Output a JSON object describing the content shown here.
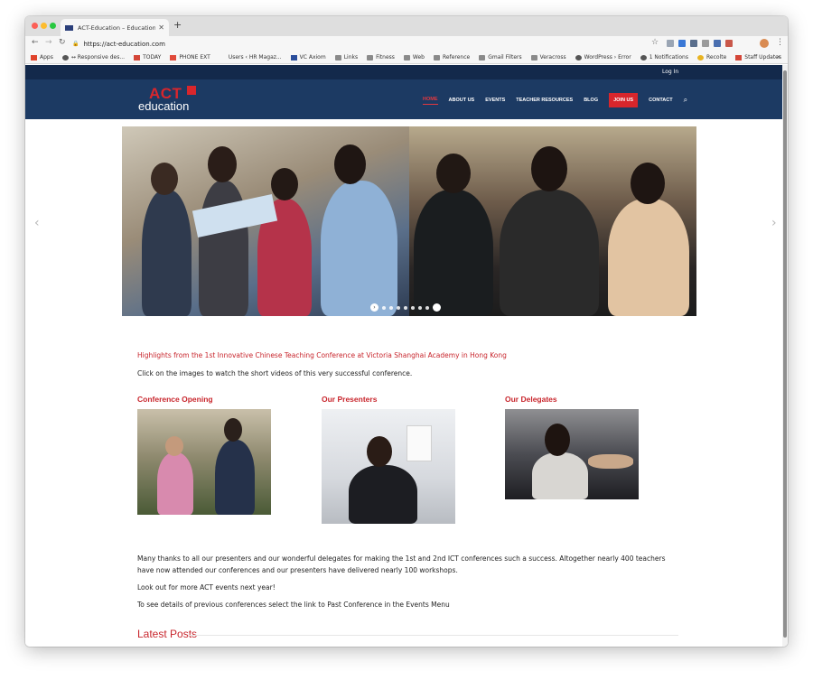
{
  "browser": {
    "tab_title": "ACT-Education – Educational",
    "url": "https://act-education.com",
    "bookmarks": [
      {
        "label": "Apps",
        "icon": "apps-icon"
      },
      {
        "label": "↔ Responsive des...",
        "icon": "globe-icon"
      },
      {
        "label": "TODAY",
        "icon": "gmail-icon"
      },
      {
        "label": "PHONE EXT",
        "icon": "doc-icon"
      },
      {
        "label": "Users ‹ HR Magaz...",
        "icon": "blank-icon"
      },
      {
        "label": "VC Axiom",
        "icon": "v-icon"
      },
      {
        "label": "Links",
        "icon": "folder-icon"
      },
      {
        "label": "Fitness",
        "icon": "folder-icon"
      },
      {
        "label": "Web",
        "icon": "folder-icon"
      },
      {
        "label": "Reference",
        "icon": "folder-icon"
      },
      {
        "label": "Gmail Filters",
        "icon": "folder-icon"
      },
      {
        "label": "Veracross",
        "icon": "folder-icon"
      },
      {
        "label": "WordPress › Error",
        "icon": "globe-icon"
      },
      {
        "label": "1 Notifications",
        "icon": "globe-icon"
      },
      {
        "label": "Recolte",
        "icon": "recolte-icon"
      },
      {
        "label": "Staff Updates",
        "icon": "gmail-icon"
      }
    ],
    "more": "»"
  },
  "site": {
    "login": "Log In",
    "logo": {
      "act": "ACT",
      "education": "education"
    },
    "nav": {
      "home": "HOME",
      "about": "ABOUT US",
      "events": "EVENTS",
      "resources": "TEACHER RESOURCES",
      "blog": "BLOG",
      "join": "JOIN US",
      "contact": "CONTACT"
    },
    "colors": {
      "topbar": "#13294b",
      "navbar": "#1c3a63",
      "accent": "#d8262c"
    }
  },
  "slider": {
    "dots": 7,
    "active": 0
  },
  "content": {
    "highlight": "Highlights from the 1st Innovative Chinese Teaching Conference at Victoria Shanghai Academy in Hong Kong",
    "intro": "Click on the images to watch the short videos of this very successful conference.",
    "columns": [
      {
        "title": "Conference Opening"
      },
      {
        "title": "Our Presenters"
      },
      {
        "title": "Our Delegates"
      }
    ],
    "para1": "Many thanks to all our presenters and our wonderful delegates for making the 1st and 2nd ICT conferences such a success. Altogether nearly 400 teachers have now attended our conferences and our presenters have delivered nearly 100 workshops.",
    "para2": "Look out for more ACT events next year!",
    "para3": "To see details of previous conferences select the link to Past Conference in the Events Menu",
    "latest": "Latest Posts"
  }
}
